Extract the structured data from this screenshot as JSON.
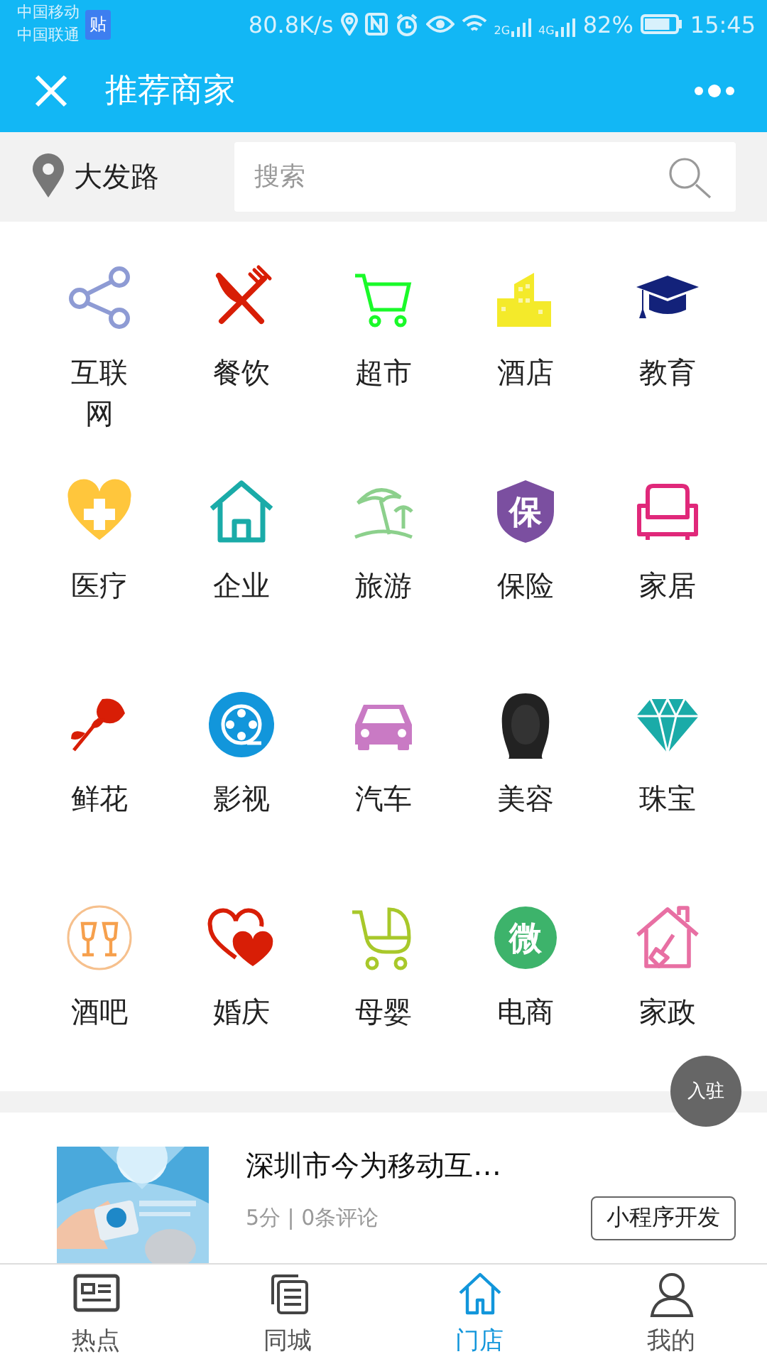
{
  "status_bar": {
    "carriers": [
      "中国移动",
      "中国联通"
    ],
    "badge": "贴",
    "speed": "80.8K/s",
    "net_a": "2G",
    "net_b": "4G",
    "battery": {
      "text": "82%",
      "level": 0.82
    },
    "time": "15:45"
  },
  "header": {
    "title": "推荐商家"
  },
  "search": {
    "location": "大发路",
    "placeholder": "搜索"
  },
  "categories": [
    {
      "label": "互联网",
      "kind": "share"
    },
    {
      "label": "餐饮",
      "kind": "dining"
    },
    {
      "label": "超市",
      "kind": "cart"
    },
    {
      "label": "酒店",
      "kind": "building"
    },
    {
      "label": "教育",
      "kind": "cap"
    },
    {
      "label": "医疗",
      "kind": "medical"
    },
    {
      "label": "企业",
      "kind": "house"
    },
    {
      "label": "旅游",
      "kind": "beach"
    },
    {
      "label": "保险",
      "kind": "shield",
      "glyph": "保"
    },
    {
      "label": "家居",
      "kind": "sofa"
    },
    {
      "label": "鲜花",
      "kind": "rose"
    },
    {
      "label": "影视",
      "kind": "film"
    },
    {
      "label": "汽车",
      "kind": "car"
    },
    {
      "label": "美容",
      "kind": "hair"
    },
    {
      "label": "珠宝",
      "kind": "diamond"
    },
    {
      "label": "酒吧",
      "kind": "glasses"
    },
    {
      "label": "婚庆",
      "kind": "hearts"
    },
    {
      "label": "母婴",
      "kind": "stroller"
    },
    {
      "label": "电商",
      "kind": "roundel",
      "glyph": "微"
    },
    {
      "label": "家政",
      "kind": "home"
    }
  ],
  "float_button": "入驻",
  "shops": [
    {
      "name": "深圳市今为移动互…",
      "rating": "5分 | 0条评论",
      "tag": "小程序开发"
    }
  ],
  "tabs": [
    {
      "label": "热点",
      "kind": "news",
      "selected": false
    },
    {
      "label": "同城",
      "kind": "pages",
      "selected": false
    },
    {
      "label": "门店",
      "kind": "store",
      "selected": true
    },
    {
      "label": "我的",
      "kind": "person",
      "selected": false
    }
  ]
}
